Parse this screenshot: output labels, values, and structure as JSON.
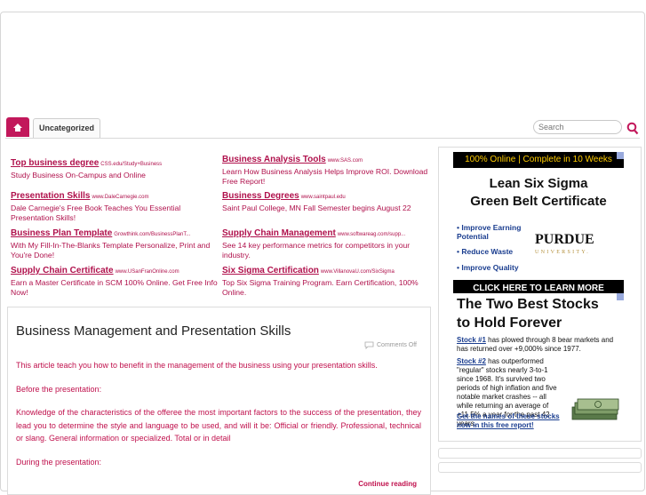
{
  "nav": {
    "home_label": "",
    "category": "Uncategorized",
    "search_placeholder": "Search"
  },
  "ads": [
    {
      "title": "Top business degree",
      "url": "CSS.edu/Study+Business",
      "desc": "Study Business On-Campus and Online"
    },
    {
      "title": "Business Analysis Tools",
      "url": "www.SAS.com",
      "desc": "Learn How Business Analysis Helps Improve ROI. Download Free Report!"
    },
    {
      "title": "Presentation Skills",
      "url": "www.DaleCarnegie.com",
      "desc": "Dale Carnegie's Free Book Teaches You Essential Presentation Skills!"
    },
    {
      "title": "Business Degrees",
      "url": "www.saintpaul.edu",
      "desc": "Saint Paul College, MN Fall Semester begins August 22"
    },
    {
      "title": "Business Plan Template",
      "url": "Growthink.com/BusinessPlanT...",
      "desc": "With My Fill-In-The-Blanks Template Personalize, Print and You're Done!"
    },
    {
      "title": "Supply Chain Management",
      "url": "www.softwareag.com/supp...",
      "desc": "See 14 key performance metrics for competitors in your industry."
    },
    {
      "title": "Supply Chain Certificate",
      "url": "www.USanFranOnline.com",
      "desc": "Earn a Master Certificate in SCM 100% Online. Get Free Info Now!"
    },
    {
      "title": "Six Sigma Certification",
      "url": "www.VillanovaU.com/SixSigma",
      "desc": "Top Six Sigma Training Program. Earn Certification, 100% Online."
    }
  ],
  "post": {
    "title": "Business Management and Presentation Skills",
    "comments": "Comments Off",
    "paragraphs": [
      "This article teach you how to benefit in the management of the business using your presentation skills.",
      "Before the presentation:",
      "Knowledge of the characteristics of the offeree the most important factors to the success of the presentation, they lead you to determine the style and language to be used, and will it be: Official or friendly. Professional, technical or slang. General information or specialized. Total or in detail",
      "During the presentation:"
    ],
    "more": "Continue reading"
  },
  "sidebar": {
    "ad1": {
      "top": "100% Online  |  Complete in 10 Weeks",
      "headline1": "Lean Six Sigma",
      "headline2": "Green Belt Certificate",
      "bullets": [
        "• Improve Earning Potential",
        "• Reduce Waste",
        "• Improve Quality"
      ],
      "brand": "PURDUE",
      "brand_sub": "UNIVERSITY.",
      "cta": "CLICK HERE TO LEARN MORE"
    },
    "ad2": {
      "headline1": "The Two Best Stocks",
      "headline2": "to Hold Forever",
      "p1_label": "Stock #1",
      "p1_text": " has plowed through 8 bear markets and has returned over +9,000% since 1977.",
      "p2_label": "Stock #2",
      "p2_text": " has outperformed \"regular\" stocks nearly 3-to-1 since 1968. It's survived two periods of high inflation and five notable market crashes -- all while returning an average of +11.5% a year for the past 42 years.",
      "link": "Get the names of these stocks now in this free report!"
    }
  },
  "colors": {
    "accent": "#c2185b",
    "ad_text": "#b0114c",
    "link_blue": "#1a3d8f"
  }
}
